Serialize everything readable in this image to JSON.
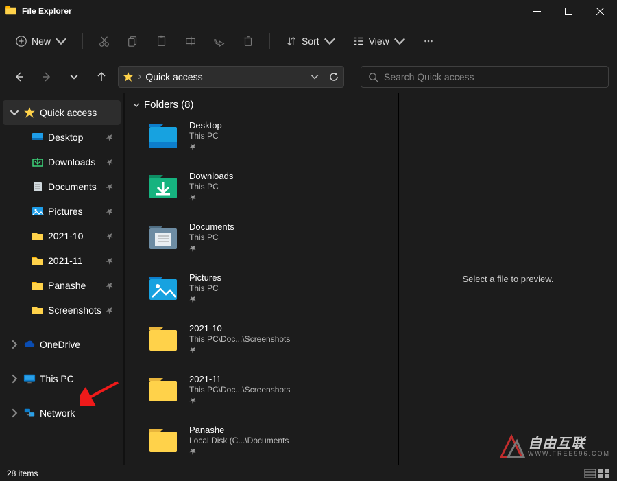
{
  "titlebar": {
    "title": "File Explorer"
  },
  "toolbar": {
    "new": "New",
    "sort": "Sort",
    "view": "View"
  },
  "address": {
    "path": "Quick access",
    "search_placeholder": "Search Quick access"
  },
  "sidebar": {
    "quick_access": "Quick access",
    "items": [
      {
        "label": "Desktop",
        "pinned": true
      },
      {
        "label": "Downloads",
        "pinned": true
      },
      {
        "label": "Documents",
        "pinned": true
      },
      {
        "label": "Pictures",
        "pinned": true
      },
      {
        "label": "2021-10",
        "pinned": true
      },
      {
        "label": "2021-11",
        "pinned": true
      },
      {
        "label": "Panashe",
        "pinned": true
      },
      {
        "label": "Screenshots",
        "pinned": true
      }
    ],
    "onedrive": "OneDrive",
    "this_pc": "This PC",
    "network": "Network"
  },
  "folders_header": "Folders (8)",
  "folders": [
    {
      "name": "Desktop",
      "path": "This PC",
      "icon": "desktop"
    },
    {
      "name": "Downloads",
      "path": "This PC",
      "icon": "downloads"
    },
    {
      "name": "Documents",
      "path": "This PC",
      "icon": "documents"
    },
    {
      "name": "Pictures",
      "path": "This PC",
      "icon": "pictures"
    },
    {
      "name": "2021-10",
      "path": "This PC\\Doc...\\Screenshots",
      "icon": "folder"
    },
    {
      "name": "2021-11",
      "path": "This PC\\Doc...\\Screenshots",
      "icon": "folder"
    },
    {
      "name": "Panashe",
      "path": "Local Disk (C...\\Documents",
      "icon": "folder"
    }
  ],
  "preview": {
    "message": "Select a file to preview."
  },
  "statusbar": {
    "count": "28 items"
  },
  "watermark": {
    "big": "自由互联",
    "url": "WWW.FREE996.COM"
  }
}
